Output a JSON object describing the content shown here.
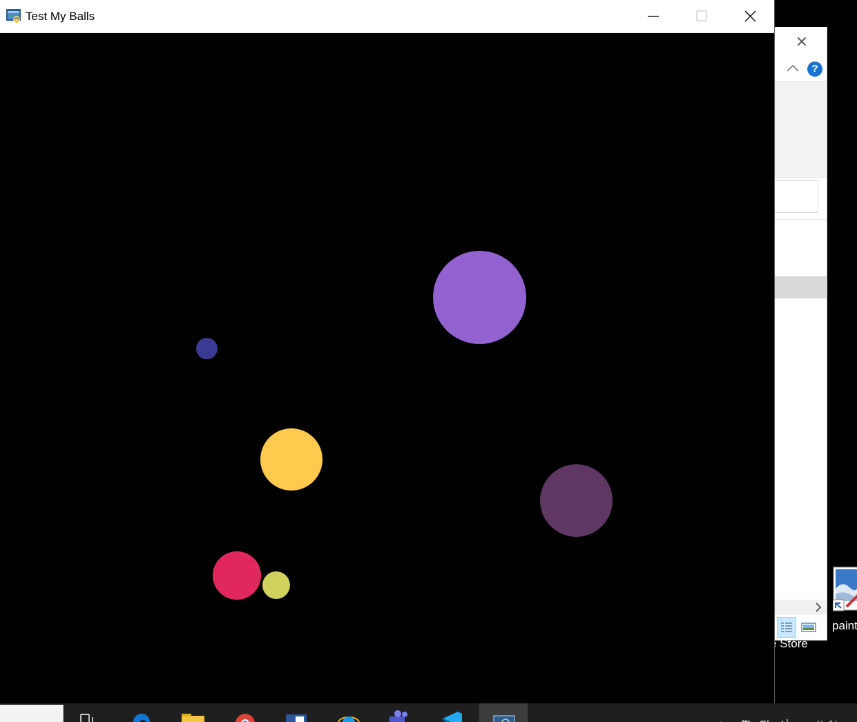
{
  "window": {
    "title": "Test My Balls",
    "icon": "python-icon",
    "controls": [
      "minimize-icon",
      "maximize-icon",
      "close-icon"
    ]
  },
  "canvas": {
    "background": "#000000",
    "balls": [
      {
        "name": "ball-large-violet",
        "color": "#9262d0"
      },
      {
        "name": "ball-small-navy",
        "color": "#3a3a94"
      },
      {
        "name": "ball-yellow",
        "color": "#ffca4d"
      },
      {
        "name": "ball-plum",
        "color": "#5e3763"
      },
      {
        "name": "ball-crimson",
        "color": "#e0285f"
      },
      {
        "name": "ball-olive-yellow",
        "color": "#cfd25c"
      }
    ]
  },
  "background_window": {
    "help_label": "?",
    "status_text": "e Store"
  },
  "desktop_icon": {
    "label": "paint"
  },
  "taskbar": {
    "items": [
      "task-view-icon",
      "edge-icon",
      "file-explorer-icon",
      "chrome-icon",
      "word-icon",
      "internet-explorer-icon",
      "teams-icon",
      "vscode-icon",
      "python-app-icon"
    ]
  }
}
